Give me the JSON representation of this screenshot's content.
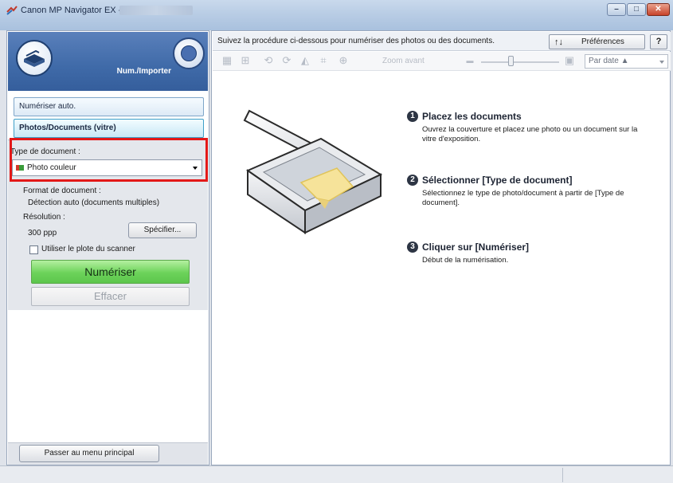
{
  "window": {
    "title": "Canon MP Navigator EX -"
  },
  "left_panel": {
    "mode_title": "Num./Importer",
    "tabs": [
      {
        "label": "Numériser auto."
      },
      {
        "label": "Photos/Documents (vitre)"
      }
    ],
    "document_type": {
      "label": "Type de document :",
      "selected": "Photo couleur"
    },
    "document_format": {
      "label": "Format de document :",
      "value": "Détection auto (documents multiples)"
    },
    "resolution": {
      "label": "Résolution :",
      "value": "300 ppp",
      "specify_button": "Spécifier..."
    },
    "use_scanner_platen": {
      "label": "Utiliser le plote du scanner",
      "checked": false
    },
    "scan_button": "Numériser",
    "clear_button": "Effacer",
    "main_menu_button": "Passer au menu principal"
  },
  "right_panel": {
    "instruction": "Suivez la procédure ci-dessous pour numériser des photos ou des documents.",
    "preferences_button": "Préférences",
    "help_button": "?",
    "toolbar": {
      "zoom_label": "Zoom avant",
      "sort_select": "Par date ▲"
    },
    "steps": [
      {
        "number": "1",
        "title": "Placez les documents",
        "description": "Ouvrez la couverture et placez une photo ou un document sur la vitre d'exposition."
      },
      {
        "number": "2",
        "title": "Sélectionner [Type de document]",
        "description": "Sélectionnez le type de photo/document à partir de [Type de document]."
      },
      {
        "number": "3",
        "title": "Cliquer sur [Numériser]",
        "description": "Début de la numérisation."
      }
    ]
  },
  "colors": {
    "highlight": "#e31818",
    "scan_button": "#6cd25a",
    "mode_header": "#3f6aa8"
  }
}
